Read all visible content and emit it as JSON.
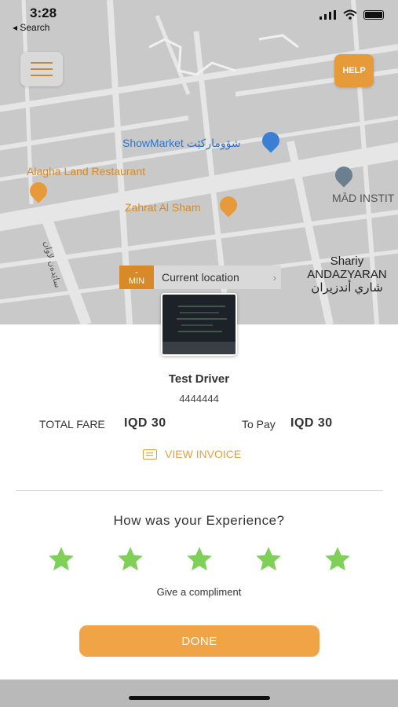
{
  "status_bar": {
    "time": "3:28",
    "back_label": "◂ Search"
  },
  "map": {
    "help_label": "HELP",
    "pois": {
      "showmarket": "ShowMarket شۆومارکێت",
      "alagha": "Alagha Land Restaurant",
      "zahrat": "Zahrat Al Sham",
      "mad": "MĀD INSTIT",
      "road_arabic": "ساێدەن لاوان"
    },
    "current_location": {
      "min_label": "MIN",
      "min_value": "-",
      "label": "Current location"
    },
    "street": {
      "line1": "Shariy",
      "line2": "ANDAZYARAN",
      "line3": "شاري أندزيران"
    }
  },
  "trip": {
    "driver_name": "Test Driver",
    "driver_phone": "4444444",
    "total_fare_label": "TOTAL FARE",
    "total_fare_value": "IQD 30",
    "to_pay_label": "To Pay",
    "to_pay_value": "IQD 30",
    "view_invoice": "VIEW INVOICE"
  },
  "rating": {
    "title": "How was your Experience?",
    "star_count": 5,
    "star_color": "#7fd057",
    "compliment": "Give a compliment",
    "done_label": "DONE"
  },
  "colors": {
    "accent": "#f0a445",
    "map_bg": "#c9c9c9"
  }
}
